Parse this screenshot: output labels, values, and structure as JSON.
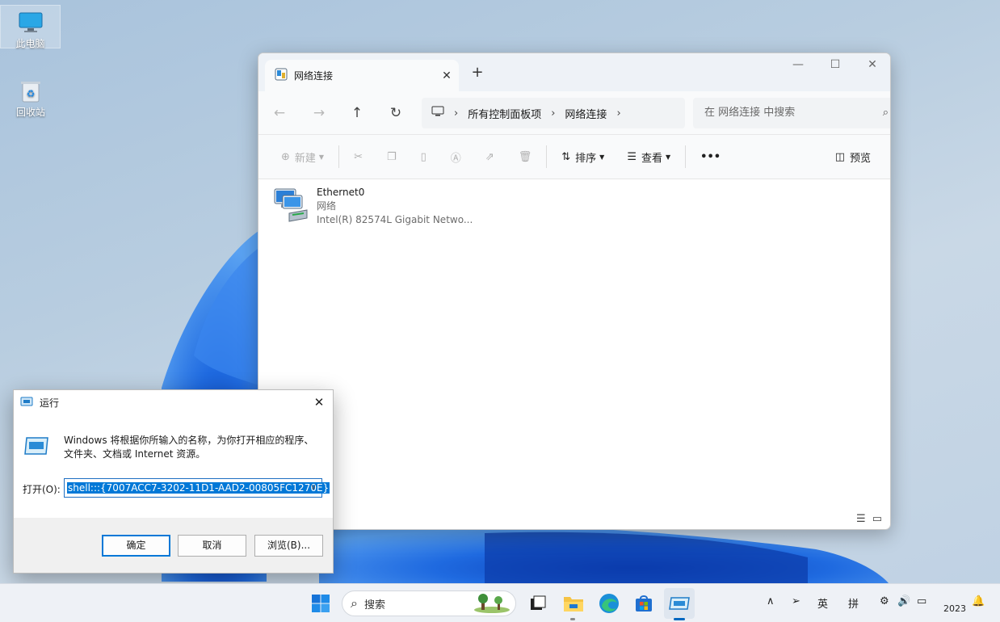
{
  "desktop": {
    "icons": [
      {
        "label": "此电脑"
      },
      {
        "label": "回收站"
      }
    ]
  },
  "explorer": {
    "tab_title": "网络连接",
    "breadcrumb": [
      "所有控制面板项",
      "网络连接"
    ],
    "search_placeholder": "在 网络连接 中搜索",
    "toolbar": {
      "new_label": "新建",
      "sort_label": "排序",
      "view_label": "查看",
      "more_label": "•••",
      "preview_label": "预览"
    },
    "items": [
      {
        "name": "Ethernet0",
        "type": "网络",
        "adapter": "Intel(R) 82574L Gigabit Netwo..."
      }
    ]
  },
  "run_dialog": {
    "title": "运行",
    "description_line1": "Windows 将根据你所输入的名称，为你打开相应的程序、",
    "description_line2": "文件夹、文档或 Internet 资源。",
    "open_label": "打开(O):",
    "open_value": "shell:::{7007ACC7-3202-11D1-AAD2-00805FC1270E}",
    "ok_label": "确定",
    "cancel_label": "取消",
    "browse_label": "浏览(B)..."
  },
  "taskbar": {
    "search_label": "搜索",
    "ime_lang": "英",
    "ime_mode": "拼",
    "clock": "2023"
  },
  "colors": {
    "accent": "#0078d7",
    "wallpaper_bloom": "#1f6ae0"
  }
}
